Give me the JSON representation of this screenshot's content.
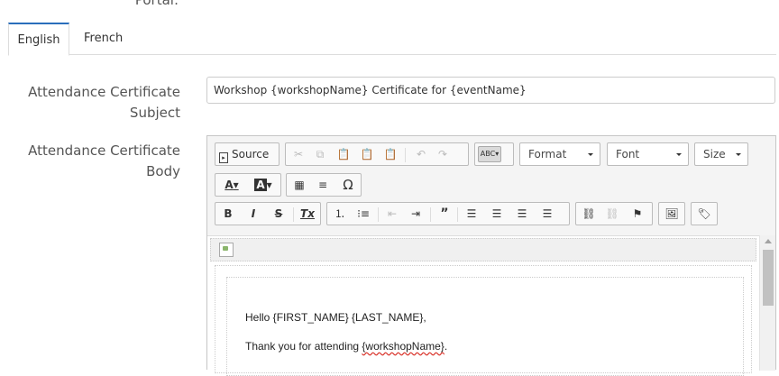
{
  "top_label": "Portal:",
  "tabs": [
    {
      "label": "English",
      "active": true
    },
    {
      "label": "French",
      "active": false
    }
  ],
  "subject": {
    "label_line1": "Attendance Certificate",
    "label_line2": "Subject",
    "value": "Workshop {workshopName} Certificate for {eventName}"
  },
  "body": {
    "label_line1": "Attendance Certificate",
    "label_line2": "Body"
  },
  "toolbar": {
    "source_label": "Source",
    "format_label": "Format",
    "font_label": "Font",
    "size_label": "Size",
    "spell_label": "ABC",
    "text_color_label": "A",
    "bg_color_label": "A",
    "bold_label": "B",
    "italic_label": "I",
    "strike_label": "S",
    "clear_format_label": "Tx",
    "special_char_label": "Ω"
  },
  "content": {
    "line1": "Hello {FIRST_NAME} {LAST_NAME},",
    "line2_prefix": "Thank you for attending ",
    "line2_word": "{workshopName}",
    "line2_suffix": "."
  },
  "colors": {
    "accent": "#2a6ebb",
    "spell_error": "#d9342b"
  }
}
